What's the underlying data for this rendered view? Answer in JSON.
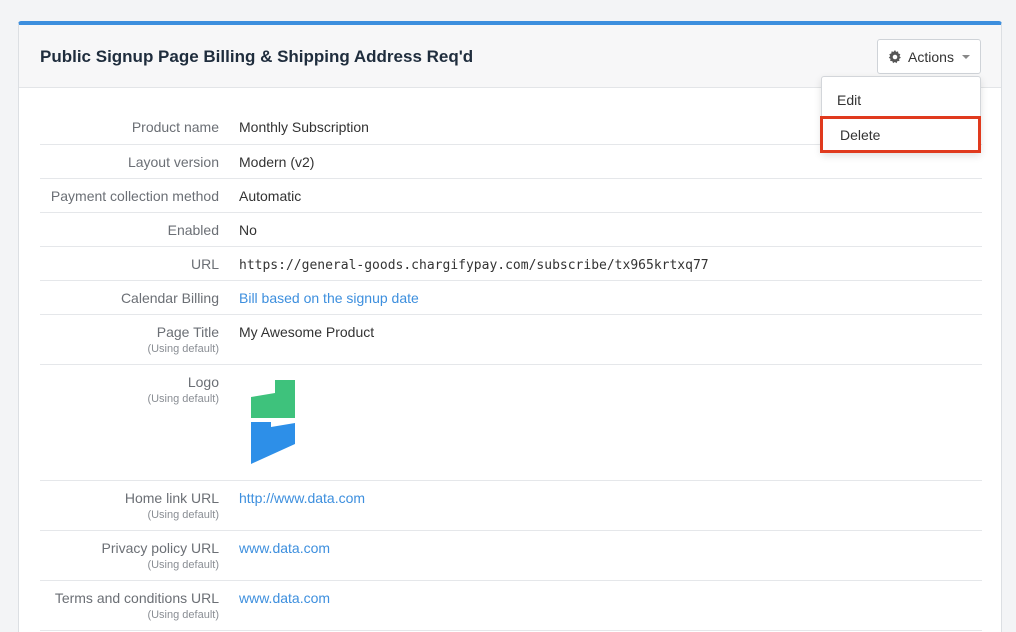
{
  "panel": {
    "title": "Public Signup Page Billing & Shipping Address Req'd",
    "accent_color": "#3d8fde"
  },
  "actions": {
    "label": "Actions",
    "icon": "gear-icon",
    "menu": {
      "edit_label": "Edit",
      "delete_label": "Delete",
      "highlight_color": "#e03a1e"
    }
  },
  "details": {
    "product_name": {
      "label": "Product name",
      "value": "Monthly Subscription"
    },
    "layout_version": {
      "label": "Layout version",
      "value": "Modern (v2)"
    },
    "payment_method": {
      "label": "Payment collection method",
      "value": "Automatic"
    },
    "enabled": {
      "label": "Enabled",
      "value": "No"
    },
    "url": {
      "label": "URL",
      "value": "https://general-goods.chargifypay.com/subscribe/tx965krtxq77"
    },
    "calendar_billing": {
      "label": "Calendar Billing",
      "value": "Bill based on the signup date"
    },
    "page_title": {
      "label": "Page Title",
      "note": "(Using default)",
      "value": "My Awesome Product"
    },
    "logo": {
      "label": "Logo",
      "note": "(Using default)",
      "icon": "chargify-logo-icon",
      "colors": [
        "#3ec27c",
        "#2d8fe8"
      ]
    },
    "home_link": {
      "label": "Home link URL",
      "note": "(Using default)",
      "value": "http://www.data.com"
    },
    "privacy_policy": {
      "label": "Privacy policy URL",
      "note": "(Using default)",
      "value": "www.data.com"
    },
    "terms": {
      "label": "Terms and conditions URL",
      "note": "(Using default)",
      "value": "www.data.com"
    }
  }
}
